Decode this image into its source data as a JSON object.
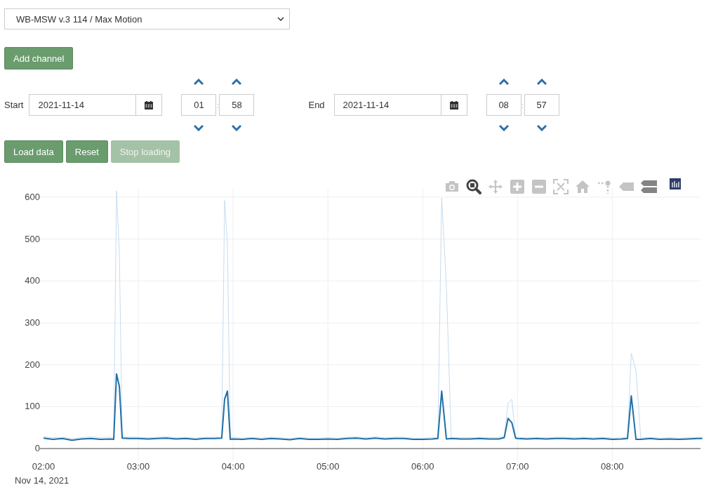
{
  "channel_select": {
    "value": "WB-MSW v.3 114 / Max Motion"
  },
  "add_button": {
    "label": "Add channel"
  },
  "ranges": [
    {
      "label": "Start",
      "date": "2021-11-14",
      "hour": "01",
      "minute": "58",
      "separator": ":"
    },
    {
      "label": "End",
      "date": "2021-11-14",
      "hour": "08",
      "minute": "57",
      "separator": ":"
    }
  ],
  "actions": [
    {
      "label": "Load data",
      "disabled": false
    },
    {
      "label": "Reset",
      "disabled": false
    },
    {
      "label": "Stop loading",
      "disabled": true
    }
  ],
  "modebar": [
    {
      "kind": "camera",
      "selected": false
    },
    {
      "kind": "zoom",
      "selected": true
    },
    {
      "kind": "pan",
      "selected": false
    },
    {
      "kind": "zoomin",
      "selected": false
    },
    {
      "kind": "zoomout",
      "selected": false
    },
    {
      "kind": "autoscale",
      "selected": false
    },
    {
      "kind": "home",
      "selected": false
    },
    {
      "kind": "spikes",
      "selected": false
    },
    {
      "kind": "closest",
      "selected": false
    },
    {
      "kind": "compare",
      "selected": false
    },
    {
      "kind": "logo",
      "selected": false
    }
  ],
  "chart": {
    "date_label": "Nov 14, 2021",
    "chart_data": {
      "type": "line",
      "x": [
        2.0,
        2.1,
        2.2,
        2.3,
        2.4,
        2.5,
        2.6,
        2.7,
        2.74,
        2.77,
        2.8,
        2.83,
        2.9,
        3.0,
        3.1,
        3.2,
        3.3,
        3.4,
        3.5,
        3.6,
        3.7,
        3.8,
        3.88,
        3.91,
        3.94,
        3.97,
        4.0,
        4.1,
        4.2,
        4.3,
        4.4,
        4.5,
        4.6,
        4.7,
        4.8,
        4.9,
        5.0,
        5.1,
        5.2,
        5.3,
        5.4,
        5.5,
        5.6,
        5.7,
        5.8,
        5.9,
        6.0,
        6.1,
        6.16,
        6.2,
        6.25,
        6.3,
        6.4,
        6.5,
        6.6,
        6.7,
        6.8,
        6.86,
        6.9,
        6.94,
        6.98,
        7.0,
        7.1,
        7.2,
        7.3,
        7.4,
        7.5,
        7.6,
        7.7,
        7.8,
        7.9,
        8.0,
        8.1,
        8.16,
        8.2,
        8.25,
        8.3,
        8.4,
        8.5,
        8.6,
        8.7,
        8.8,
        8.9,
        8.95
      ],
      "series": [
        {
          "color": "#c6dcee",
          "values": [
            28,
            26,
            27,
            24,
            26,
            28,
            26,
            27,
            26,
            615,
            462,
            28,
            27,
            27,
            26,
            27,
            28,
            26,
            27,
            25,
            27,
            27,
            28,
            592,
            487,
            25,
            26,
            25,
            27,
            25,
            27,
            26,
            24,
            27,
            25,
            25,
            26,
            25,
            27,
            28,
            26,
            28,
            26,
            27,
            27,
            25,
            25,
            26,
            27,
            598,
            388,
            27,
            26,
            26,
            27,
            26,
            26,
            29,
            108,
            118,
            28,
            27,
            26,
            27,
            26,
            27,
            27,
            26,
            27,
            26,
            27,
            25,
            26,
            27,
            228,
            187,
            25,
            27,
            25,
            26,
            25,
            26,
            27,
            27
          ]
        },
        {
          "color": "#1f6fa6",
          "values": [
            25,
            22,
            24,
            20,
            23,
            24,
            22,
            23,
            22,
            178,
            148,
            25,
            24,
            24,
            23,
            24,
            25,
            23,
            24,
            22,
            24,
            24,
            25,
            118,
            137,
            22,
            23,
            22,
            24,
            22,
            24,
            23,
            21,
            24,
            22,
            22,
            23,
            22,
            24,
            25,
            23,
            25,
            23,
            24,
            24,
            22,
            22,
            23,
            24,
            137,
            23,
            24,
            23,
            23,
            24,
            23,
            23,
            26,
            72,
            62,
            25,
            24,
            23,
            24,
            23,
            24,
            24,
            23,
            24,
            23,
            24,
            22,
            23,
            24,
            126,
            22,
            22,
            24,
            22,
            23,
            22,
            23,
            24,
            24
          ]
        }
      ],
      "grid": true,
      "xlim": [
        1.985,
        8.96
      ],
      "ylim": [
        -30,
        620
      ],
      "xticks": [
        {
          "value": 2,
          "label": "02:00"
        },
        {
          "value": 3,
          "label": "03:00"
        },
        {
          "value": 4,
          "label": "04:00"
        },
        {
          "value": 5,
          "label": "05:00"
        },
        {
          "value": 6,
          "label": "06:00"
        },
        {
          "value": 7,
          "label": "07:00"
        },
        {
          "value": 8,
          "label": "08:00"
        }
      ],
      "yticks": [
        0,
        100,
        200,
        300,
        400,
        500,
        600
      ]
    }
  }
}
